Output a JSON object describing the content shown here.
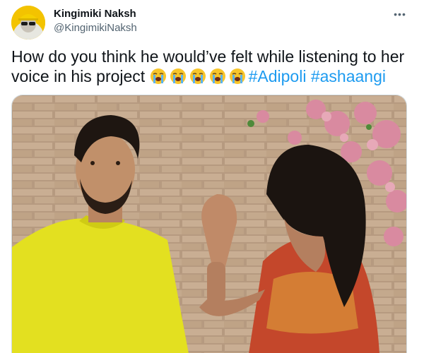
{
  "tweet": {
    "display_name": "Kingimiki Naksh",
    "handle": "@KingimikiNaksh",
    "text_prefix": "How do you think he would’ve felt while listening to her voice in his project",
    "emoji": [
      "loudly-crying-face",
      "loudly-crying-face",
      "loudly-crying-face",
      "loudly-crying-face",
      "loudly-crying-face"
    ],
    "hashtags": [
      "#Adipoli",
      "#ashaangi"
    ],
    "more_label": "•••"
  },
  "media": {
    "description_icon": "video-still",
    "watermark": ""
  },
  "colors": {
    "link": "#1d9bf0",
    "text": "#0f1419",
    "secondary": "#536471",
    "shirt": "#e6e01e",
    "wall": "#b89a7e",
    "blossom": "#d98aa0"
  }
}
